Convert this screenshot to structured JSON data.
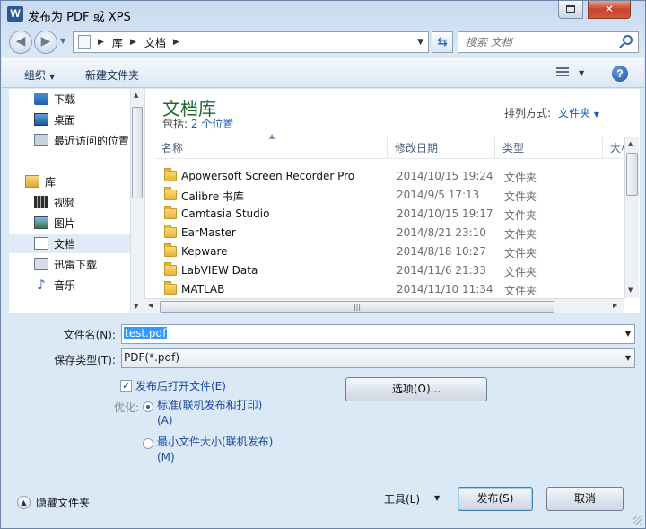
{
  "window": {
    "app_icon": "W",
    "title": "发布为 PDF 或 XPS",
    "close_glyph": "✕"
  },
  "address": {
    "crumbs": [
      "库",
      "文档"
    ],
    "search_placeholder": "搜索 文档"
  },
  "toolbar": {
    "organize": "组织",
    "new_folder": "新建文件夹",
    "help": "?"
  },
  "nav": {
    "items": [
      {
        "label": "下载",
        "icon": "download-icon"
      },
      {
        "label": "桌面",
        "icon": "desktop-icon"
      },
      {
        "label": "最近访问的位置",
        "icon": "recent-places-icon"
      },
      {
        "label": "库",
        "icon": "library-icon"
      },
      {
        "label": "视频",
        "icon": "video-icon"
      },
      {
        "label": "图片",
        "icon": "pictures-icon"
      },
      {
        "label": "文档",
        "icon": "documents-icon"
      },
      {
        "label": "迅雷下载",
        "icon": "xunlei-icon"
      },
      {
        "label": "音乐",
        "icon": "music-icon"
      }
    ]
  },
  "library": {
    "title": "文档库",
    "includes_label": "包括:",
    "includes_link": "2 个位置",
    "arrange_label": "排列方式:",
    "arrange_value": "文件夹"
  },
  "columns": {
    "name": "名称",
    "date": "修改日期",
    "type": "类型",
    "size": "大小"
  },
  "files": [
    {
      "name": "Apowersoft Screen Recorder Pro",
      "date": "2014/10/15 19:24",
      "type": "文件夹"
    },
    {
      "name": "Calibre 书库",
      "date": "2014/9/5 17:13",
      "type": "文件夹"
    },
    {
      "name": "Camtasia Studio",
      "date": "2014/10/15 19:17",
      "type": "文件夹"
    },
    {
      "name": "EarMaster",
      "date": "2014/8/21 23:10",
      "type": "文件夹"
    },
    {
      "name": "Kepware",
      "date": "2014/8/18 10:27",
      "type": "文件夹"
    },
    {
      "name": "LabVIEW Data",
      "date": "2014/11/6 21:33",
      "type": "文件夹"
    },
    {
      "name": "MATLAB",
      "date": "2014/11/10 11:34",
      "type": "文件夹"
    }
  ],
  "form": {
    "filename_label": "文件名(N):",
    "filename_value": "test.pdf",
    "savetype_label": "保存类型(T):",
    "savetype_value": "PDF(*.pdf)",
    "open_after_label": "发布后打开文件(E)",
    "open_after_checked": true,
    "checkmark": "✓",
    "optimize_label": "优化:",
    "standard_label": "标准(联机发布和打印)(A)",
    "minimum_label": "最小文件大小(联机发布)(M)",
    "options_button": "选项(O)...",
    "tools_label": "工具(L)",
    "publish_button": "发布(S)",
    "cancel_button": "取消",
    "hide_folders": "隐藏文件夹"
  }
}
